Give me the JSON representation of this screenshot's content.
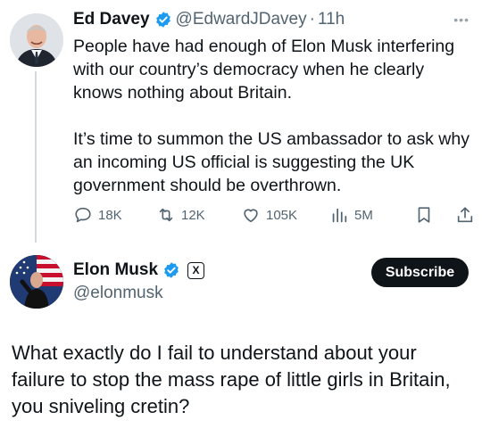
{
  "tweets": [
    {
      "author_name": "Ed Davey",
      "handle": "@EdwardJDavey",
      "separator": "·",
      "time": "11h",
      "paragraphs": [
        "People have had enough of Elon Musk interfering with our country’s democracy when he clearly knows nothing about Britain.",
        "It’s time to summon the US ambassador to ask why an incoming US official is suggesting the UK government should be overthrown."
      ],
      "stats": {
        "replies": "18K",
        "reposts": "12K",
        "likes": "105K",
        "views": "5M"
      }
    },
    {
      "author_name": "Elon Musk",
      "handle": "@elonmusk",
      "affiliate_badge": "X",
      "subscribe_label": "Subscribe",
      "text": "What exactly do I fail to understand about your failure to stop the mass rape of little girls in Britain, you sniveling cretin?"
    }
  ],
  "colors": {
    "text": "#0f1419",
    "secondary": "#536471",
    "verified_blue": "#1d9bf0",
    "button_bg": "#0f1419"
  }
}
